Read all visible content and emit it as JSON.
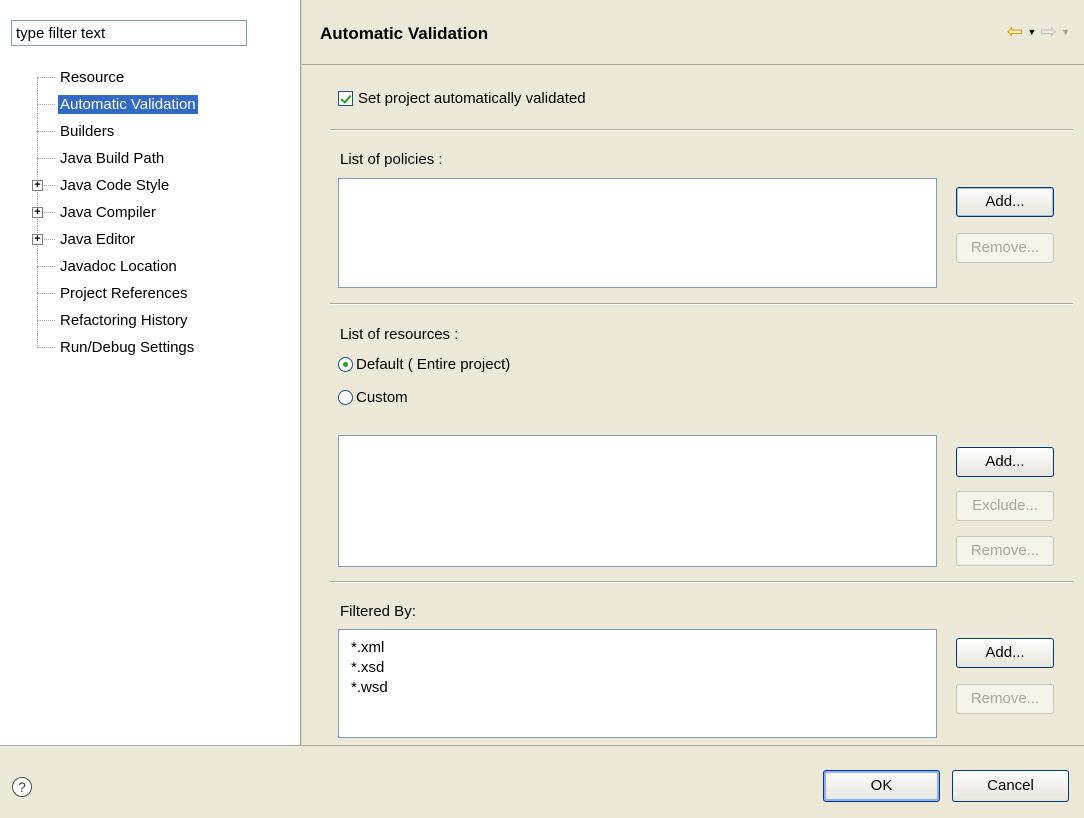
{
  "filter": {
    "placeholder": "type filter text"
  },
  "tree": [
    {
      "label": "Resource",
      "expandable": false
    },
    {
      "label": "Automatic Validation",
      "expandable": false,
      "selected": true
    },
    {
      "label": "Builders",
      "expandable": false
    },
    {
      "label": "Java Build Path",
      "expandable": false
    },
    {
      "label": "Java Code Style",
      "expandable": true
    },
    {
      "label": "Java Compiler",
      "expandable": true
    },
    {
      "label": "Java Editor",
      "expandable": true
    },
    {
      "label": "Javadoc Location",
      "expandable": false
    },
    {
      "label": "Project References",
      "expandable": false
    },
    {
      "label": "Refactoring History",
      "expandable": false
    },
    {
      "label": "Run/Debug Settings",
      "expandable": false
    }
  ],
  "page": {
    "title": "Automatic Validation",
    "auto_validate_label": "Set project automatically validated",
    "auto_validate_checked": true
  },
  "policies": {
    "label": "List of policies :",
    "add": "Add...",
    "remove": "Remove..."
  },
  "resources": {
    "label": "List of resources :",
    "default_option": "Default ( Entire project)",
    "custom_option": "Custom",
    "add": "Add...",
    "exclude": "Exclude...",
    "remove": "Remove..."
  },
  "filtered": {
    "label": "Filtered By:",
    "items": [
      "*.xml",
      "*.xsd",
      "*.wsd"
    ],
    "add": "Add...",
    "remove": "Remove..."
  },
  "dialog": {
    "ok": "OK",
    "cancel": "Cancel",
    "help_icon": "?"
  },
  "colors": {
    "selection": "#316ac5",
    "back_arrow": "#e0a000",
    "check_green": "#21a121"
  }
}
